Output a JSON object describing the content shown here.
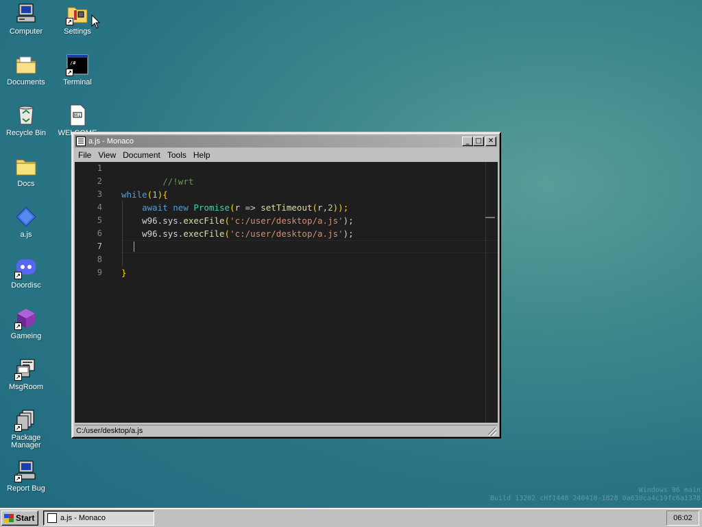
{
  "desktop": {
    "icons": [
      {
        "label": "Computer",
        "icon": "computer-icon"
      },
      {
        "label": "Settings",
        "icon": "settings-folder-icon"
      },
      {
        "label": "Documents",
        "icon": "documents-folder-icon"
      },
      {
        "label": "Terminal",
        "icon": "terminal-icon"
      },
      {
        "label": "Recycle Bin",
        "icon": "recycle-bin-icon"
      },
      {
        "label": "WELCOME",
        "icon": "welcome-file-icon"
      },
      {
        "label": "Docs",
        "icon": "folder-icon"
      },
      {
        "label": "a.js",
        "icon": "js-file-icon"
      },
      {
        "label": "Doordisc",
        "icon": "discord-icon"
      },
      {
        "label": "Gameing",
        "icon": "cube-icon"
      },
      {
        "label": "MsgRoom",
        "icon": "msgroom-icon"
      },
      {
        "label": "Package Manager",
        "icon": "package-manager-icon"
      },
      {
        "label": "Report Bug",
        "icon": "report-bug-icon"
      }
    ]
  },
  "window": {
    "title": "a.js - Monaco",
    "menu": [
      "File",
      "View",
      "Document",
      "Tools",
      "Help"
    ],
    "status_path": "C:/user/desktop/a.js",
    "editor": {
      "line_numbers": [
        "1",
        "2",
        "3",
        "4",
        "5",
        "6",
        "7",
        "8",
        "9"
      ],
      "lines": [
        "//!wrt",
        "",
        "while(1){",
        "    await new Promise(r => setTimeout(r,2));",
        "    w96.sys.execFile('c:/user/desktop/a.js');",
        "    w96.sys.execFile('c:/user/desktop/a.js');",
        "",
        "",
        "}"
      ],
      "tokens": {
        "l1": "//!wrt",
        "l3_kw": "while",
        "l3_open": "(",
        "l3_num": "1",
        "l3_close": "){",
        "l4_await": "await",
        "l4_new": "new",
        "l4_promise": "Promise",
        "l4_p1": "(",
        "l4_r": "r",
        "l4_arrow": " => ",
        "l4_set": "setTimeout",
        "l4_p2": "(",
        "l4_r2": "r,",
        "l4_num": "2",
        "l4_end": "));",
        "l5_obj": "w96.sys.",
        "l5_fn": "execFile",
        "l5_p": "(",
        "l5_str": "'c:/user/desktop/a.js'",
        "l5_end": ");",
        "l6_obj": "w96.sys.",
        "l6_fn": "execFile",
        "l6_p": "(",
        "l6_str": "'c:/user/desktop/a.js'",
        "l6_end": ");",
        "l9": "}"
      }
    }
  },
  "watermark": {
    "line1": "Windows 96 main",
    "line2": "Build 13202 cHf1448 240410-1828 0a630ca4c19fc6a1378"
  },
  "taskbar": {
    "start_label": "Start",
    "task_label": "a.js - Monaco",
    "clock": "06:02"
  }
}
